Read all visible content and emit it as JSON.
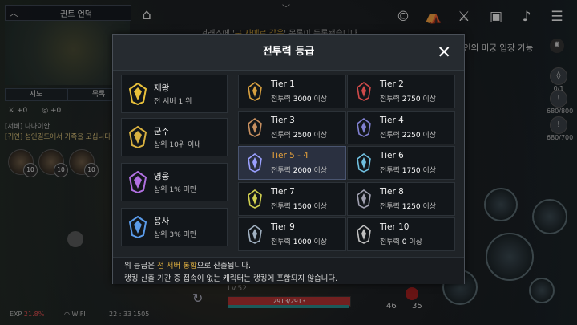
{
  "hud": {
    "zone_name": "귄트 언덕",
    "map_tab": "지도",
    "list_tab": "목록",
    "count_a": "+0",
    "count_b": "+0",
    "chat_line1": "[서버] 나나이안",
    "chat_line2": "[귀연] 성인길드에서 가족을 모십니다",
    "buff_counts": [
      "10",
      "10",
      "10"
    ],
    "notice_prefix": "겨래스에 '",
    "notice_highlight": "구 사메르 갑옷",
    "notice_suffix": "' 목록이 등록됐습니다.",
    "right_notice": "인의 미궁 입장 가능",
    "side_stat1": "0/1",
    "side_stat2": "680/800",
    "side_stat3": "680/700",
    "level_text": "Lv.52",
    "hp_text": "2913/2913",
    "count_46": "46",
    "count_35": "35",
    "exp_label": "EXP",
    "exp_value": "21.8%",
    "wifi_label": "WIFI",
    "time": "22 : 33",
    "battery": "1505"
  },
  "modal": {
    "title": "전투력 등급",
    "close_label": "✕",
    "ranks": [
      {
        "name": "제왕",
        "desc": "전 서버 1 위",
        "color": "#e8c03a"
      },
      {
        "name": "군주",
        "desc": "상위 10위 이내",
        "color": "#d8b040"
      },
      {
        "name": "영웅",
        "desc": "상위 1% 미만",
        "color": "#b070e0"
      },
      {
        "name": "용사",
        "desc": "상위 3% 미만",
        "color": "#5a9ae8"
      }
    ],
    "tiers": [
      {
        "name": "Tier 1",
        "label": "전투력",
        "value": "3000",
        "suffix": "이상",
        "color": "#d8a040"
      },
      {
        "name": "Tier 2",
        "label": "전투력",
        "value": "2750",
        "suffix": "이상",
        "color": "#d04a4a"
      },
      {
        "name": "Tier 3",
        "label": "전투력",
        "value": "2500",
        "suffix": "이상",
        "color": "#c89060"
      },
      {
        "name": "Tier 4",
        "label": "전투력",
        "value": "2250",
        "suffix": "이상",
        "color": "#8080d0"
      },
      {
        "name": "Tier 5 - 4",
        "label": "전투력",
        "value": "2000",
        "suffix": "이상",
        "color": "#9aa0ff"
      },
      {
        "name": "Tier 6",
        "label": "전투력",
        "value": "1750",
        "suffix": "이상",
        "color": "#70c0e0"
      },
      {
        "name": "Tier 7",
        "label": "전투력",
        "value": "1500",
        "suffix": "이상",
        "color": "#d0d050"
      },
      {
        "name": "Tier 8",
        "label": "전투력",
        "value": "1250",
        "suffix": "이상",
        "color": "#a0a0b0"
      },
      {
        "name": "Tier 9",
        "label": "전투력",
        "value": "1000",
        "suffix": "이상",
        "color": "#a0b0c0"
      },
      {
        "name": "Tier 10",
        "label": "전투력",
        "value": "0",
        "suffix": "이상",
        "color": "#c0c0c0"
      }
    ],
    "active_tier": "Tier 5 - 4",
    "footer_prefix": "위 등급은 ",
    "footer_highlight": "전 서버 통합",
    "footer_suffix": "으로 산출됩니다.",
    "footer_line2": "랭킹 산출 기간 중 접속이 없는 캐릭터는 랭킹에 포함되지 않습니다."
  }
}
